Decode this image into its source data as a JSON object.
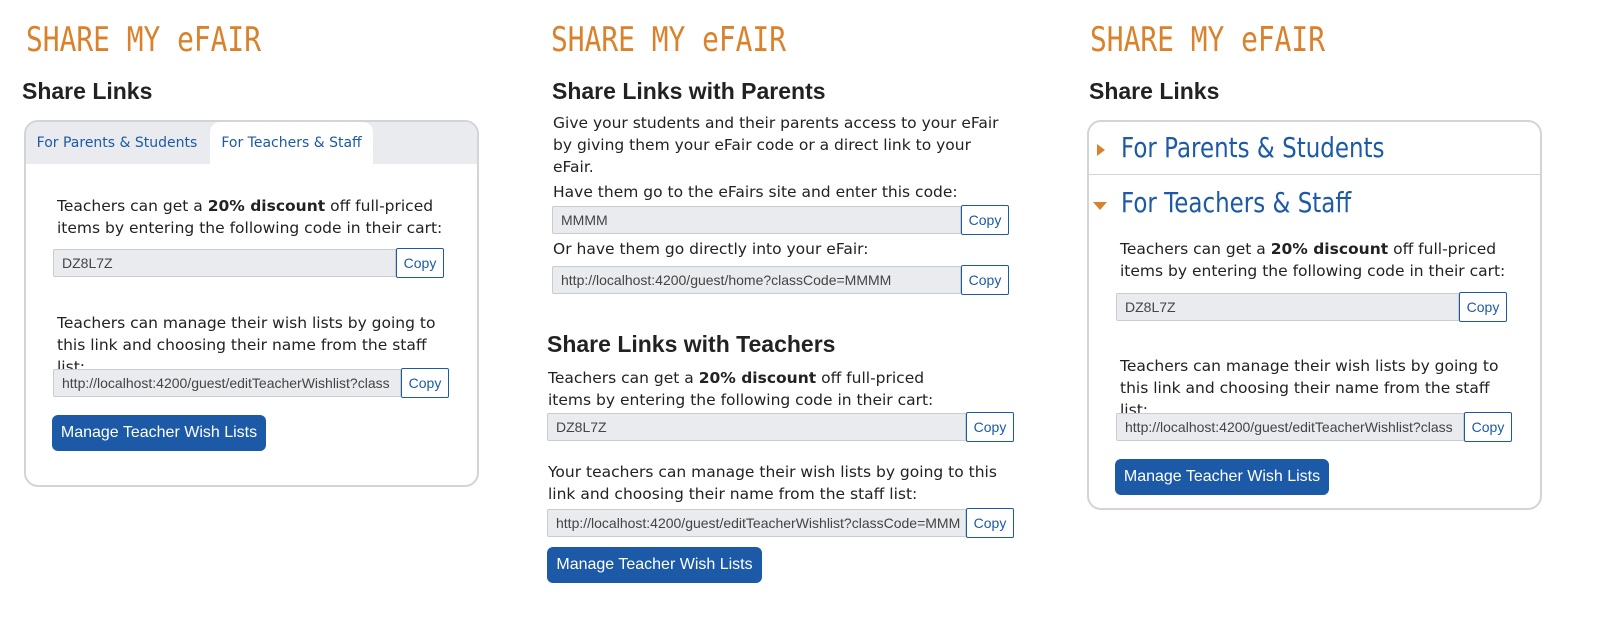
{
  "brand_title": "SHARE MY eFAIR",
  "panel1": {
    "heading": "Share Links",
    "tabs": [
      "For Parents & Students",
      "For Teachers & Staff"
    ],
    "discount_pre": "Teachers can get a ",
    "discount_bold": "20% discount",
    "discount_post": " off full-priced items by entering the following code in their cart:",
    "code_value": "DZ8L7Z",
    "copy_label": "Copy",
    "wishlist_text": "Teachers can manage their wish lists by going to this link and choosing their name from the staff list:",
    "wishlist_url": "http://localhost:4200/guest/editTeacherWishlist?class",
    "manage_button": "Manage Teacher Wish Lists"
  },
  "panel2": {
    "heading_parents": "Share Links with Parents",
    "parents_intro": "Give your students and their parents access to your eFair by giving them your eFair code or a direct link to your eFair.",
    "code_prompt": "Have them go to the eFairs site and enter this code:",
    "class_code": "MMMM",
    "link_prompt": "Or have them go directly into your eFair:",
    "class_url": "http://localhost:4200/guest/home?classCode=MMMM",
    "heading_teachers": "Share Links with Teachers",
    "discount_pre": "Teachers can get a ",
    "discount_bold": "20% discount",
    "discount_post": " off full-priced items by entering the following code in their cart:",
    "discount_code": "DZ8L7Z",
    "wishlist_text": "Your teachers can manage their wish lists by going to this link and choosing their name from the staff list:",
    "wishlist_url": "http://localhost:4200/guest/editTeacherWishlist?classCode=MMM",
    "copy_label": "Copy",
    "manage_button": "Manage Teacher Wish Lists"
  },
  "panel3": {
    "heading": "Share Links",
    "accordion_parents": "For Parents & Students",
    "accordion_teachers": "For Teachers & Staff",
    "discount_pre": "Teachers can get a ",
    "discount_bold": "20% discount",
    "discount_post": " off full-priced items by entering the following code in their cart:",
    "code_value": "DZ8L7Z",
    "wishlist_text": "Teachers can manage their wish lists by going to this link and choosing their name from the staff list:",
    "wishlist_url": "http://localhost:4200/guest/editTeacherWishlist?class",
    "copy_label": "Copy",
    "manage_button": "Manage Teacher Wish Lists"
  },
  "colors": {
    "brand_orange": "#d9822b",
    "link_blue": "#1c5aa8",
    "field_bg": "#e9ebee"
  },
  "icons": [
    "caret-right-icon",
    "caret-down-icon"
  ]
}
